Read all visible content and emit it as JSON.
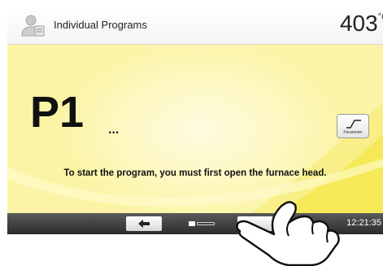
{
  "header": {
    "title": "Individual Programs",
    "temperature": "403",
    "temperature_unit": "°C",
    "user_icon": "user-icon"
  },
  "main": {
    "program_id": "P1",
    "program_name": "...",
    "parameter_button_label": "Parameter",
    "message": "To start the program, you must first open the furnace head."
  },
  "bottombar": {
    "back_icon": "arrow-left-icon",
    "page_indicator": "1 of 2",
    "clock": "12:21:35"
  },
  "colors": {
    "background_yellow": "#fbf4a6",
    "bottombar_dark": "#2b2b2b"
  }
}
